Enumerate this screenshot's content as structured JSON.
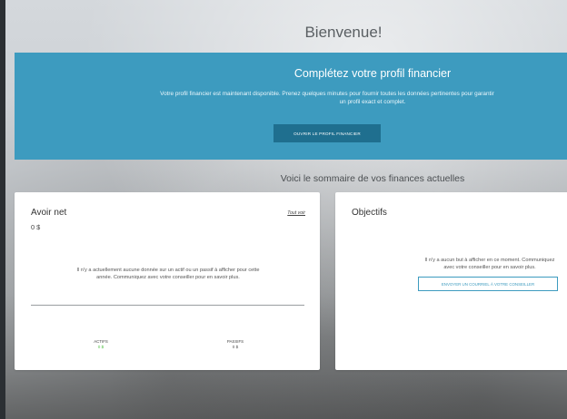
{
  "header": {
    "welcome": "Bienvenue!"
  },
  "banner": {
    "title": "Complétez votre profil financier",
    "text_line1": "Votre profil financier est maintenant disponible. Prenez quelques minutes pour fournir toutes les données pertinentes pour garantir",
    "text_line2": "un profil exact et complet.",
    "button_label": "OUVRIR LE PROFIL FINANCIER",
    "color": "#3d9bbf",
    "button_color": "#1f6f8f"
  },
  "summary": {
    "title": "Voici le sommaire de vos finances actuelles"
  },
  "net_worth": {
    "title": "Avoir net",
    "value": "0 $",
    "view_all": "Tout voir",
    "empty_message": "Il n'y a actuellement aucune donnée sur un actif ou un passif à afficher pour cette année. Communiquez avec votre conseiller pour en savoir plus.",
    "assets_label": "ACTIFS",
    "assets_value": "0 $",
    "liabilities_label": "PASSIFS",
    "liabilities_value": "0 $",
    "assets_color": "#56c24a"
  },
  "objectives": {
    "title": "Objectifs",
    "empty_line1": "Il n'y a aucun but à afficher en ce moment. Communiquez",
    "empty_line2": "avec votre conseiller pour en savoir plus.",
    "button_label": "ENVOYER UN COURRIEL À VOTRE CONSEILLER"
  }
}
